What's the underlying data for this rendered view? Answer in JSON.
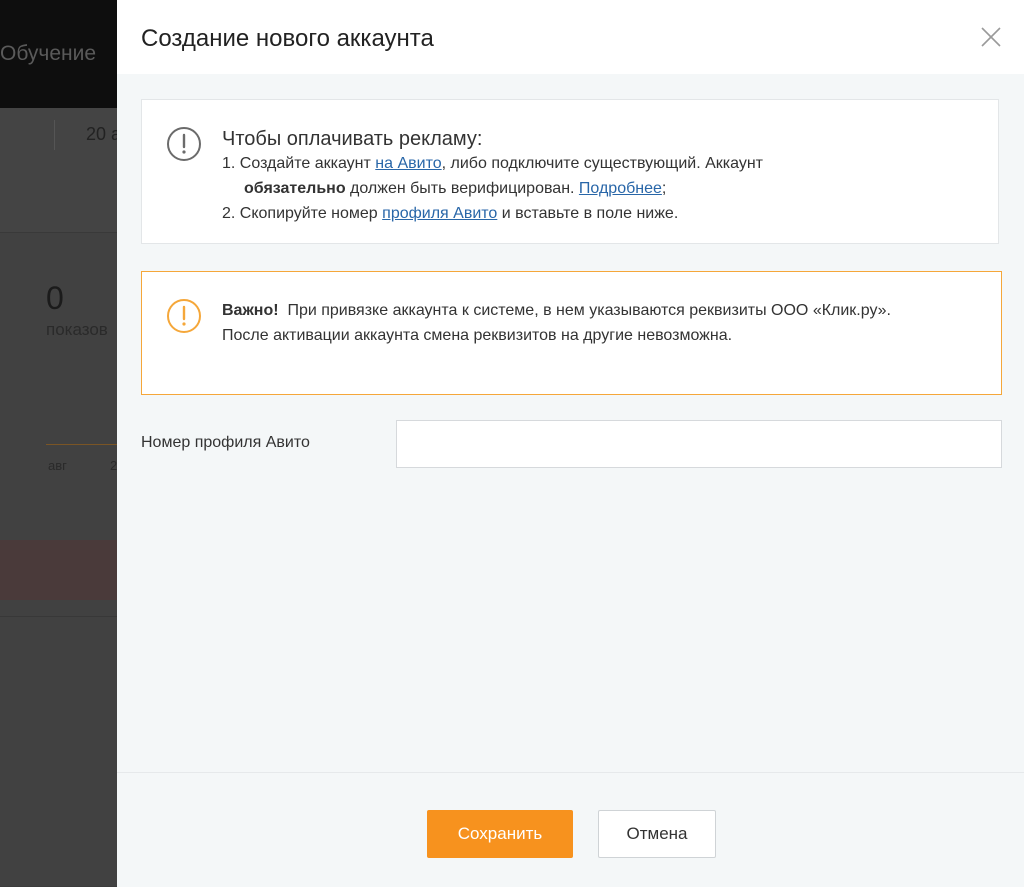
{
  "background": {
    "menu_item": "Обучение",
    "date_text": "20 а",
    "stat_value": "0",
    "stat_label": "показов",
    "axis_label_1": "авг",
    "axis_label_2": "2"
  },
  "modal": {
    "title": "Создание нового аккаунта",
    "close_icon": "close-icon",
    "info": {
      "icon": "exclamation-circle-icon",
      "heading": "Чтобы оплачивать рекламу:",
      "step1_prefix": "1. Создайте аккаунт ",
      "step1_link": "на Авито",
      "step1_suffix": ", либо подключите существующий. Аккаунт",
      "step1_bold": "обязательно",
      "step1_mid": " должен быть верифицирован. ",
      "step1_link2": "Подробнее",
      "step1_end": ";",
      "step2_prefix": "2. Скопируйте номер ",
      "step2_link": "профиля Авито",
      "step2_suffix": " и вставьте в поле ниже."
    },
    "warning": {
      "icon": "exclamation-circle-icon",
      "bold": "Важно!",
      "line1": "  При привязке аккаунта к системе, в нем указываются реквизиты ООО «Клик.ру».",
      "line2": "После активации аккаунта смена реквизитов на другие невозможна."
    },
    "field": {
      "label": "Номер профиля Авито",
      "value": "",
      "placeholder": ""
    },
    "footer": {
      "save_label": "Сохранить",
      "cancel_label": "Отмена"
    }
  },
  "colors": {
    "accent": "#f7921e",
    "link": "#2866a8",
    "warning_border": "#f5a73a",
    "info_icon": "#6b6b6b"
  }
}
